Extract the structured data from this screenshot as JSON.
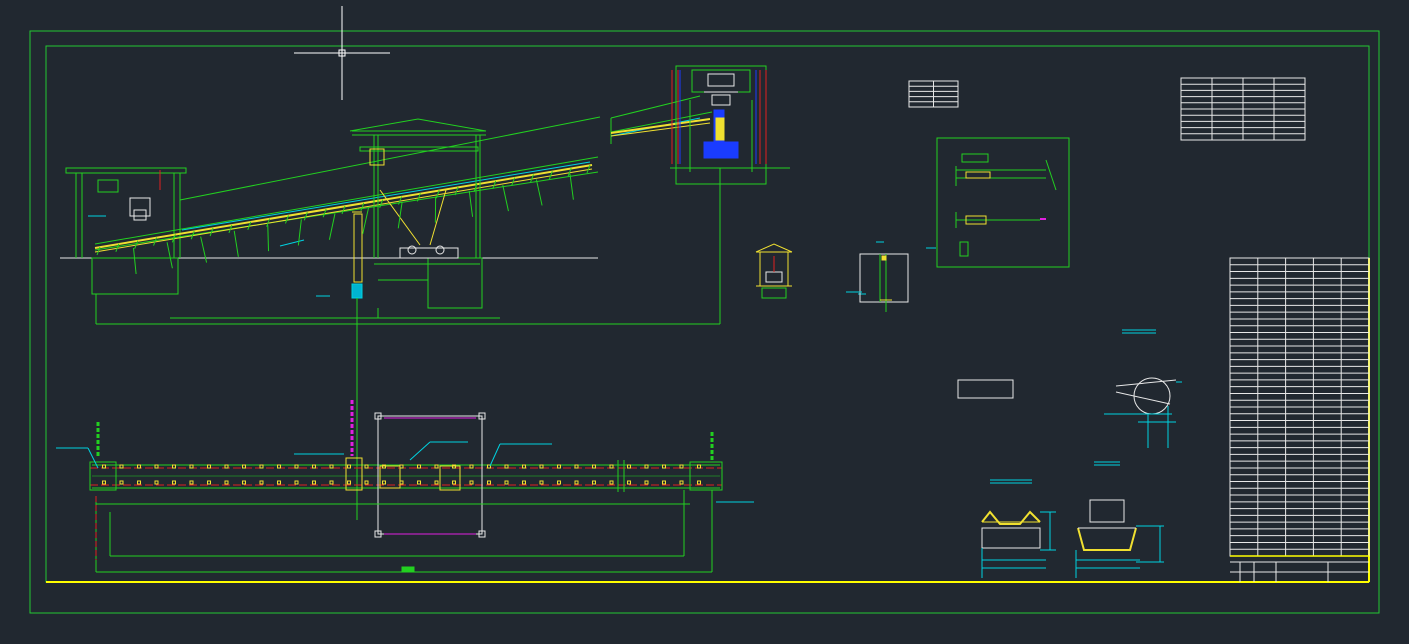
{
  "app": {
    "background": "#212830",
    "crosshair": {
      "icon": "cad-crosshair-cursor"
    }
  },
  "colors": {
    "border_outer": "#22c832",
    "border_inner": "#22c832",
    "border_bottom": "#ffff00",
    "geometry": "#22d020",
    "conveyor": "#f0e030",
    "centerline": "#e02020",
    "dimension": "#00e6e6",
    "dimension_white": "#e8e8e8",
    "motor_blue": "#1a3cff",
    "magenta": "#e020e0",
    "cyan": "#00d2e0",
    "table_lines": "#ffffff"
  },
  "drawing": {
    "views": [
      {
        "name": "side-elevation"
      },
      {
        "name": "plan-view"
      },
      {
        "name": "head-section-detail"
      },
      {
        "name": "drive-detail-panel"
      },
      {
        "name": "small-shelter-detail"
      },
      {
        "name": "frame-detail"
      },
      {
        "name": "pulley-detail"
      },
      {
        "name": "troughing-idler-section-a"
      },
      {
        "name": "troughing-idler-section-b"
      }
    ],
    "tables": [
      {
        "name": "small-note-table",
        "rows": 5,
        "cols": 2
      },
      {
        "name": "parameter-table",
        "rows": 10,
        "cols": 4
      },
      {
        "name": "bill-of-materials",
        "rows": 44,
        "cols": 5
      }
    ]
  }
}
